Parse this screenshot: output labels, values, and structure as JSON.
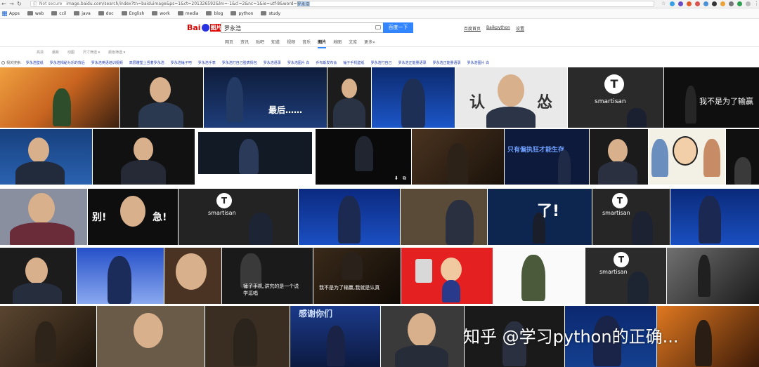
{
  "browser": {
    "secure_label": "Not secure",
    "url_prefix": "image.baidu.com/search/index?tn=baiduimage&ps=1&ct=201326592&lm=-1&cl=2&nc=1&ie=utf-8&word=",
    "url_query": "罗永浩"
  },
  "bookmarks": [
    {
      "label": "Apps",
      "icon": "apps-icon"
    },
    {
      "label": "web",
      "icon": "folder-icon"
    },
    {
      "label": "ccil",
      "icon": "folder-icon"
    },
    {
      "label": "java",
      "icon": "folder-icon"
    },
    {
      "label": "doc",
      "icon": "folder-icon"
    },
    {
      "label": "English",
      "icon": "folder-icon"
    },
    {
      "label": "work",
      "icon": "folder-icon"
    },
    {
      "label": "media",
      "icon": "folder-icon"
    },
    {
      "label": "blog",
      "icon": "folder-icon"
    },
    {
      "label": "python",
      "icon": "folder-icon"
    },
    {
      "label": "study",
      "icon": "folder-icon"
    }
  ],
  "search": {
    "logo_text": "Bai",
    "logo_img": "图片",
    "query": "罗永浩",
    "button": "百度一下"
  },
  "header_links": [
    "百度首页",
    "Baikpython",
    "设置"
  ],
  "tabs": [
    {
      "label": "网页",
      "active": false
    },
    {
      "label": "资讯",
      "active": false
    },
    {
      "label": "贴吧",
      "active": false
    },
    {
      "label": "知道",
      "active": false
    },
    {
      "label": "视频",
      "active": false
    },
    {
      "label": "音乐",
      "active": false
    },
    {
      "label": "图片",
      "active": true
    },
    {
      "label": "地图",
      "active": false
    },
    {
      "label": "文库",
      "active": false
    },
    {
      "label": "更多»",
      "active": false
    }
  ],
  "filters": [
    "高清",
    "最新",
    "动图",
    "尺寸筛选 ▾",
    "颜色筛选 ▾"
  ],
  "related": {
    "lead": "相关搜索:",
    "keywords": [
      "罗永浩壁纸",
      "罗永浩揭秘为乐的背后",
      "罗永浩英语培训视频",
      "高层雕塑上竖着罗永浩",
      "罗永浩锤子吧",
      "罗永浩手表",
      "罗永浩打自己脸表情包",
      "罗永浩语录",
      "罗永浩图片 白",
      "乔布斯发布会",
      "锤子手机壁纸",
      "罗永浩打自己",
      "罗永浩正能量语录",
      "罗永浩正能量语录",
      "罗永浩图片 白"
    ]
  },
  "tile_captions": {
    "r0_2": "最后……",
    "r0_5a": "认",
    "r0_5b": "怂",
    "r0_6": "smartisan",
    "r0_7": "我不是为了输赢",
    "r1_4": "只有偏执狂才能生存",
    "r2_1a": "别!",
    "r2_1b": "急!",
    "r2_2": "smartisan",
    "r2_6": "了!",
    "r2_7": "smartisan",
    "r3_3": "锤子手机,讲究的是一个说学逗唱",
    "r3_4": "我不是为了输赢,我就是认真",
    "r3_7": "smartisan",
    "r4_3": "感谢你们"
  },
  "watermark": "知乎 @学习python的正确..."
}
